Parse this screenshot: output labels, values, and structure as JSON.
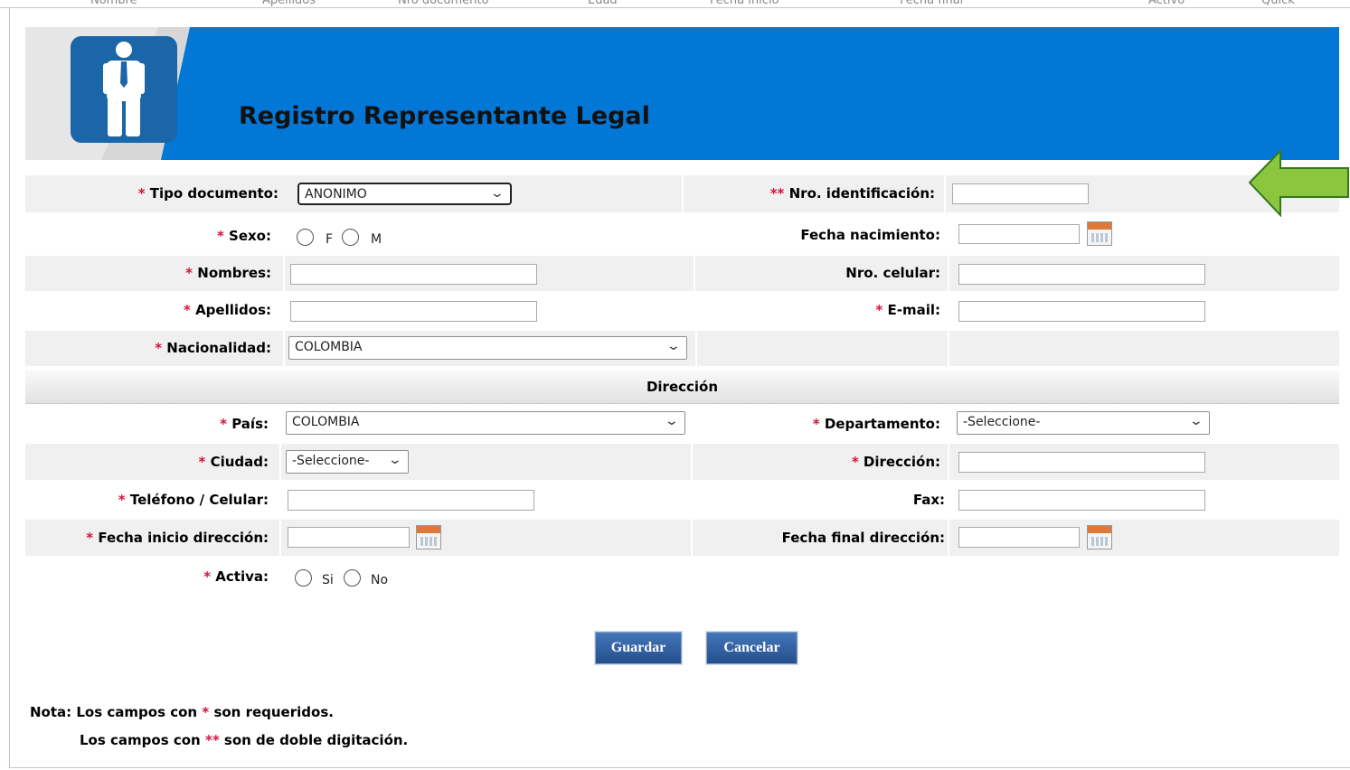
{
  "top_strip": [
    "Nombre",
    "Apellidos",
    "Nro documento",
    "Edad",
    "Fecha inicio",
    "Fecha final",
    "Activo",
    "Quick"
  ],
  "header": {
    "title": "Registro Representante Legal",
    "icon": "person-tie-icon",
    "bg_color": "#0277d6"
  },
  "form": {
    "tipo_documento": {
      "req": "*",
      "label": "Tipo documento:",
      "value": "ANONIMO"
    },
    "nro_identificacion": {
      "req": "**",
      "label": "Nro. identificación:",
      "value": ""
    },
    "sexo": {
      "req": "*",
      "label": "Sexo:",
      "options": [
        "F",
        "M"
      ]
    },
    "fecha_nacimiento": {
      "label": "Fecha nacimiento:",
      "value": ""
    },
    "nombres": {
      "req": "*",
      "label": "Nombres:",
      "value": ""
    },
    "nro_celular": {
      "label": "Nro. celular:",
      "value": ""
    },
    "apellidos": {
      "req": "*",
      "label": "Apellidos:",
      "value": ""
    },
    "email": {
      "req": "*",
      "label": "E-mail:",
      "value": ""
    },
    "nacionalidad": {
      "req": "*",
      "label": "Nacionalidad:",
      "value": "COLOMBIA"
    }
  },
  "direccion_section": "Dirección",
  "direccion": {
    "pais": {
      "req": "*",
      "label": "País:",
      "value": "COLOMBIA"
    },
    "departamento": {
      "req": "*",
      "label": "Departamento:",
      "value": "-Seleccione-"
    },
    "ciudad": {
      "req": "*",
      "label": "Ciudad:",
      "value": "-Seleccione-"
    },
    "direccion": {
      "req": "*",
      "label": "Dirección:",
      "value": ""
    },
    "telefono": {
      "req": "*",
      "label": "Teléfono / Celular:",
      "value": ""
    },
    "fax": {
      "label": "Fax:",
      "value": ""
    },
    "fecha_inicio": {
      "req": "*",
      "label": "Fecha inicio dirección:",
      "value": ""
    },
    "fecha_final": {
      "label": "Fecha final dirección:",
      "value": ""
    },
    "activa": {
      "req": "*",
      "label": "Activa:",
      "options": [
        "Si",
        "No"
      ]
    }
  },
  "buttons": {
    "save": "Guardar",
    "cancel": "Cancelar"
  },
  "notes": {
    "line1_prefix": "Nota: Los campos con",
    "line1_mark": "*",
    "line1_suffix": "son requeridos.",
    "line2_prefix": "Los campos con",
    "line2_mark": "**",
    "line2_suffix": "son de doble digitación."
  },
  "colors": {
    "required": "#d2123e",
    "button": "#2f5f9e",
    "arrow": "#8cc63f"
  }
}
